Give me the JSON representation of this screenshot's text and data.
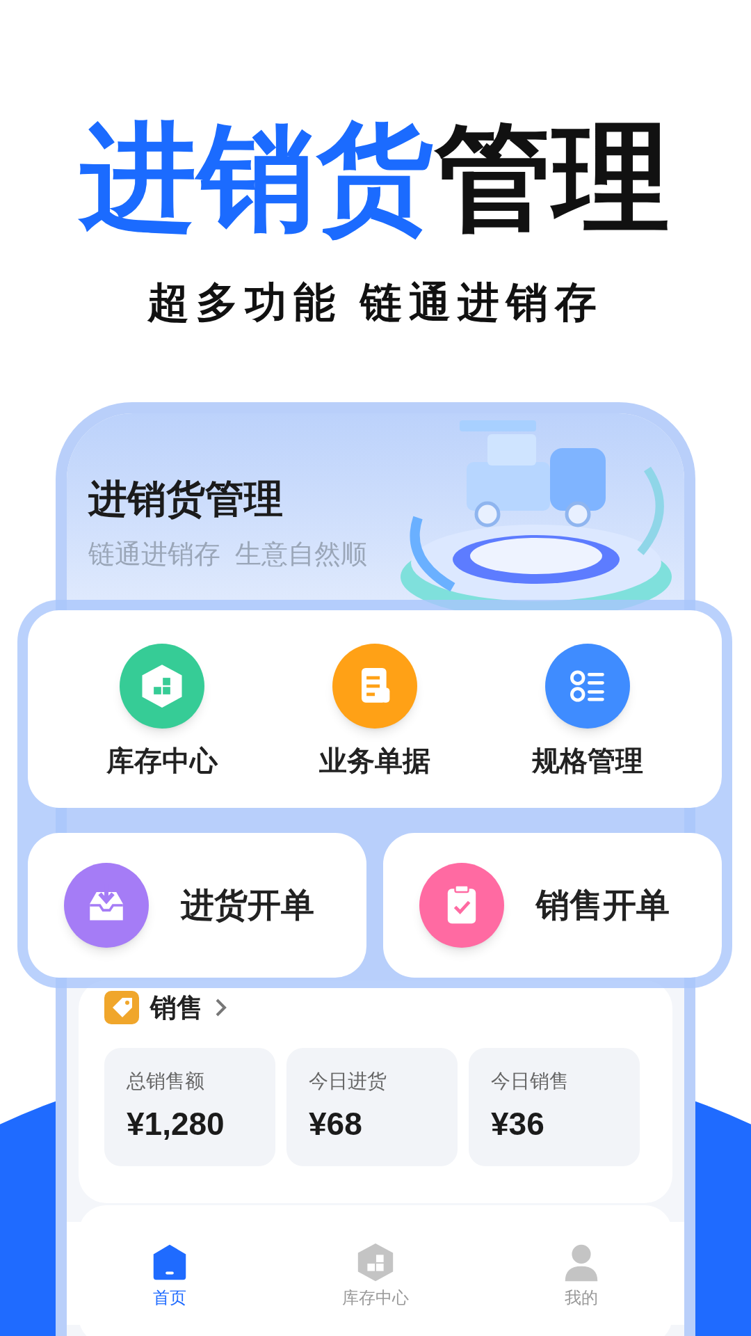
{
  "headline": [
    {
      "text": "进销货",
      "color": "#1b6bff"
    },
    {
      "text": "管理",
      "color": "#111111"
    }
  ],
  "subheadline": "超多功能 链通进销存",
  "app": {
    "banner": {
      "title": "进销货管理",
      "slogan": "链通进销存  生意自然顺"
    },
    "shortcuts": [
      {
        "label": "库存中心",
        "kind": "box",
        "color": "#36cc96"
      },
      {
        "label": "业务单据",
        "kind": "document",
        "color": "#ffa116"
      },
      {
        "label": "规格管理",
        "kind": "list",
        "color": "#3f8cff"
      }
    ],
    "actions": [
      {
        "label": "进货开单",
        "kind": "inbox",
        "color": "#a57cf6"
      },
      {
        "label": "销售开单",
        "kind": "clipboard",
        "color": "#ff6aa2"
      }
    ],
    "sales": {
      "title": "销售",
      "stats": [
        {
          "label": "总销售额",
          "value": "¥1,280"
        },
        {
          "label": "今日进货",
          "value": "¥68"
        },
        {
          "label": "今日销售",
          "value": "¥36"
        }
      ]
    },
    "tab_bar": [
      {
        "label": "首页",
        "kind": "home",
        "selected": true
      },
      {
        "label": "库存中心",
        "kind": "box",
        "selected": false
      },
      {
        "label": "我的",
        "kind": "person",
        "selected": false
      }
    ]
  }
}
